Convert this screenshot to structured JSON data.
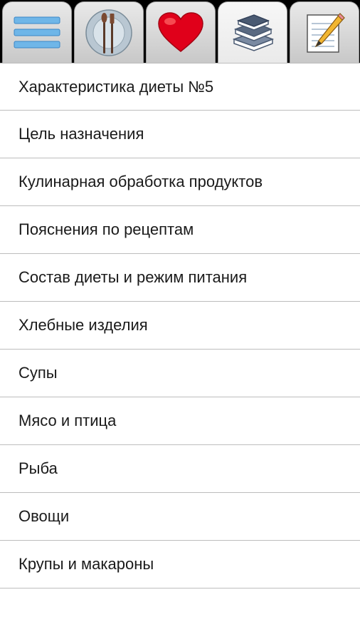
{
  "tabs": [
    {
      "icon": "menu-list-icon",
      "active": false
    },
    {
      "icon": "plate-cutlery-icon",
      "active": false
    },
    {
      "icon": "heart-icon",
      "active": false
    },
    {
      "icon": "books-icon",
      "active": true
    },
    {
      "icon": "notepad-pencil-icon",
      "active": false
    }
  ],
  "items": [
    {
      "label": "Характеристика диеты №5"
    },
    {
      "label": "Цель назначения"
    },
    {
      "label": "Кулинарная обработка продуктов"
    },
    {
      "label": "Пояснения по рецептам"
    },
    {
      "label": "Состав диеты и режим питания"
    },
    {
      "label": "Хлебные изделия"
    },
    {
      "label": "Супы"
    },
    {
      "label": "Мясо и птица"
    },
    {
      "label": "Рыба"
    },
    {
      "label": "Овощи"
    },
    {
      "label": "Крупы и макароны"
    }
  ],
  "colors": {
    "heart": "#e0001a",
    "menu_lines": "#6fb6e8",
    "books": "#4a5a72",
    "pencil": "#f2b630"
  }
}
